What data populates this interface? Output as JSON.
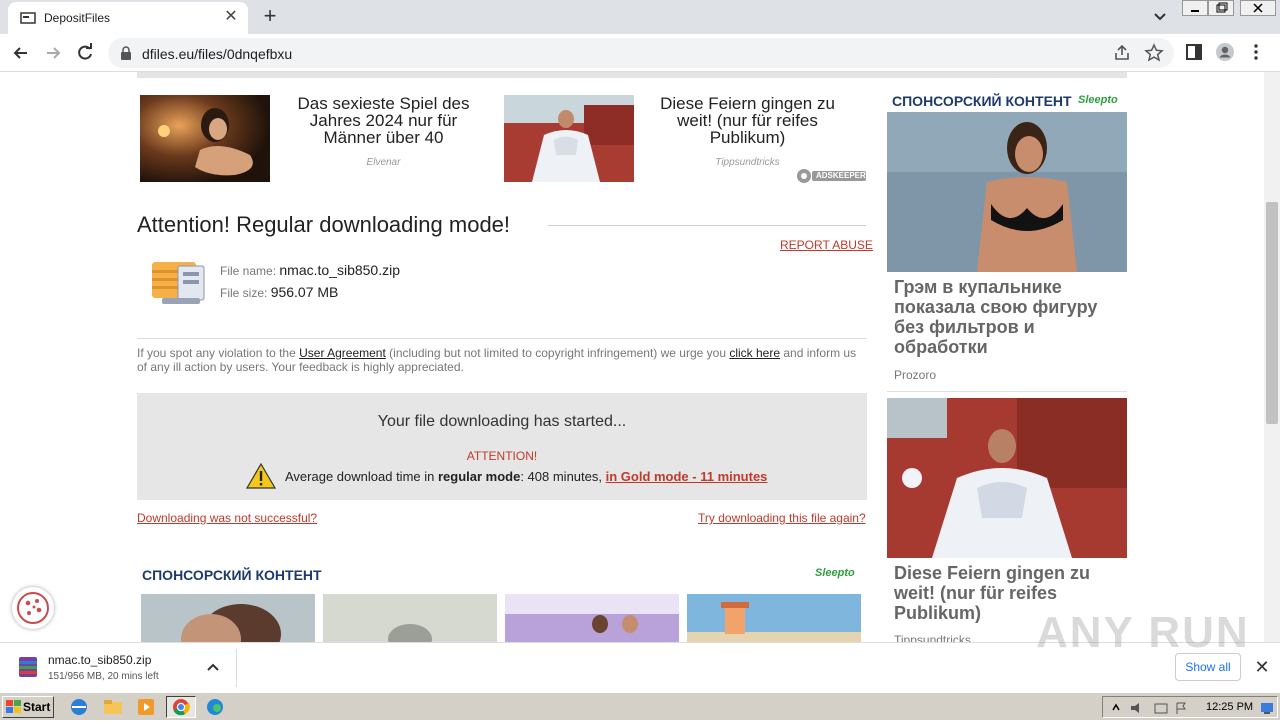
{
  "browser": {
    "tab_title": "DepositFiles",
    "url": "dfiles.eu/files/0dnqefbxu"
  },
  "top_ads": [
    {
      "headline": "Das sexieste Spiel des Jahres 2024 nur für Männer über 40",
      "source": "Elvenar"
    },
    {
      "headline": "Diese Feiern gingen zu weit! (nur für reifes Publikum)",
      "source": "Tippsundtricks"
    }
  ],
  "adskeeper_label": "ADSKEEPER",
  "attention_title": "Attention! Regular downloading mode!",
  "report_abuse": "REPORT ABUSE",
  "file": {
    "name_label": "File name:",
    "name": "nmac.to_sib850.zip",
    "size_label": "File size:",
    "size": "956.07 MB"
  },
  "notice": {
    "part1": "If you spot any violation to the ",
    "link1": "User Agreement",
    "part2": " (including but not limited to copyright infringement) we urge you ",
    "link2": "click here",
    "part3": " and inform us of any ill action by users. Your feedback is highly appreciated."
  },
  "download_box": {
    "started": "Your file downloading has started...",
    "attention": "ATTENTION!",
    "avg_prefix": "Average download time in ",
    "avg_mode": "regular mode",
    "avg_mid": ": 408 minutes, ",
    "gold_link": "in Gold mode - 11 minutes"
  },
  "links": {
    "not_successful": "Downloading was not successful?",
    "try_again": "Try downloading this file again?"
  },
  "sponsored": {
    "label": "СПОНСОРСКИЙ КОНТЕНТ",
    "brand": "Sleepto"
  },
  "right_ads": [
    {
      "headline": "Грэм в купальнике показала свою фигуру без фильтров и обработки",
      "source": "Prozoro"
    },
    {
      "headline": "Diese Feiern gingen zu weit! (nur für reifes Publikum)",
      "source": "Tippsundtricks"
    }
  ],
  "download_bar": {
    "filename": "nmac.to_sib850.zip",
    "status": "151/956 MB, 20 mins left",
    "show_all": "Show all"
  },
  "watermark": "ANY RUN",
  "taskbar": {
    "start": "Start",
    "clock": "12:25 PM"
  }
}
